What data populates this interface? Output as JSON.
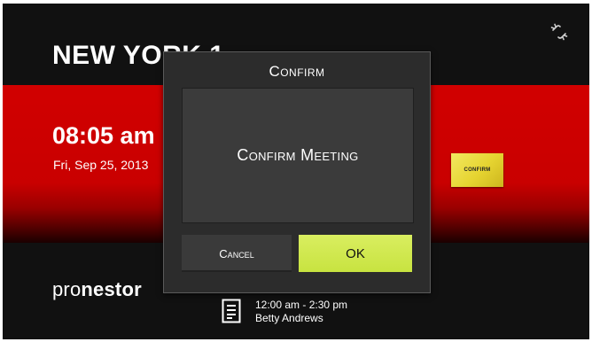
{
  "room": {
    "title": "NEW YORK 1"
  },
  "clock": {
    "time": "08:05 am",
    "date": "Fri, Sep 25, 2013"
  },
  "status_chip": {
    "label": "CONFIRM"
  },
  "branding": {
    "logo_light": "pro",
    "logo_bold": "nestor"
  },
  "current_meeting": {
    "time_range": "12:00 am - 2:30 pm",
    "organizer": "Betty Andrews"
  },
  "dialog": {
    "title": "Confirm",
    "message": "Confirm Meeting",
    "cancel_label": "Cancel",
    "ok_label": "OK"
  },
  "icons": {
    "top_right": "broken-link-icon",
    "meeting": "document-icon"
  },
  "colors": {
    "accent_red": "#d10000",
    "ok_button": "#c8e340",
    "chip_yellow": "#e6d431",
    "background": "#111111"
  }
}
